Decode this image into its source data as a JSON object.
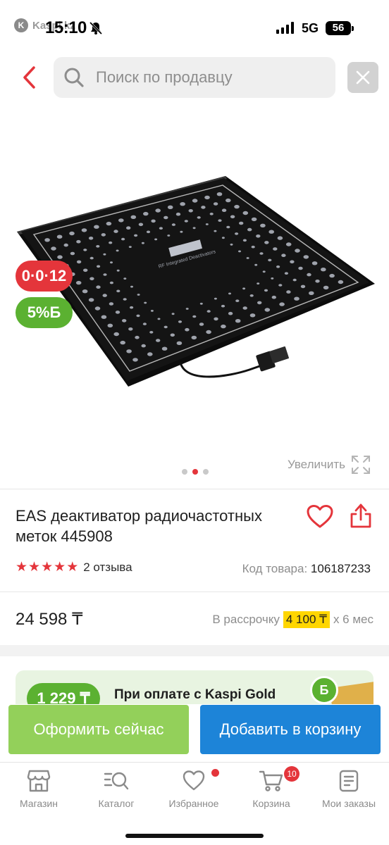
{
  "status_bar": {
    "app_hint": "Kaspi.kz",
    "time": "15:10",
    "network": "5G",
    "battery": "56"
  },
  "search": {
    "placeholder": "Поиск по продавцу",
    "icon": "search-icon"
  },
  "gallery": {
    "credit_badge": "0·0·12",
    "bonus_badge_value": "5%",
    "bonus_badge_symbol": "Б",
    "slide_count": 3,
    "active_slide": 2,
    "zoom_label": "Увеличить",
    "product_print": "RF Integrated Deactivators"
  },
  "product": {
    "title": "EAS деактиватор радиочастотных меток 445908",
    "rating_stars": 5,
    "reviews": "2 отзыва",
    "sku_label": "Код товара:",
    "sku_value": "106187233"
  },
  "pricing": {
    "price": "24 598 ₸",
    "installment_prefix": "В рассрочку",
    "installment_amount": "4 100 ₸",
    "installment_suffix": "х 6 мес"
  },
  "promo": {
    "bonus": "1 229 ₸",
    "text": "При оплате с Kaspi Gold",
    "coin_symbol": "Б"
  },
  "actions": {
    "buy_now": "Оформить сейчас",
    "add_to_cart": "Добавить в корзину"
  },
  "nav": {
    "items": [
      {
        "label": "Магазин",
        "icon": "store-icon"
      },
      {
        "label": "Каталог",
        "icon": "catalog-icon"
      },
      {
        "label": "Избранное",
        "icon": "heart-icon"
      },
      {
        "label": "Корзина",
        "icon": "cart-icon",
        "badge": "10"
      },
      {
        "label": "Мои заказы",
        "icon": "orders-icon"
      }
    ]
  },
  "colors": {
    "accent_red": "#e4353b",
    "bonus_green": "#5bb131",
    "buy_green": "#93d05a",
    "cart_blue": "#1d84d8",
    "installment_yellow": "#ffd600"
  }
}
